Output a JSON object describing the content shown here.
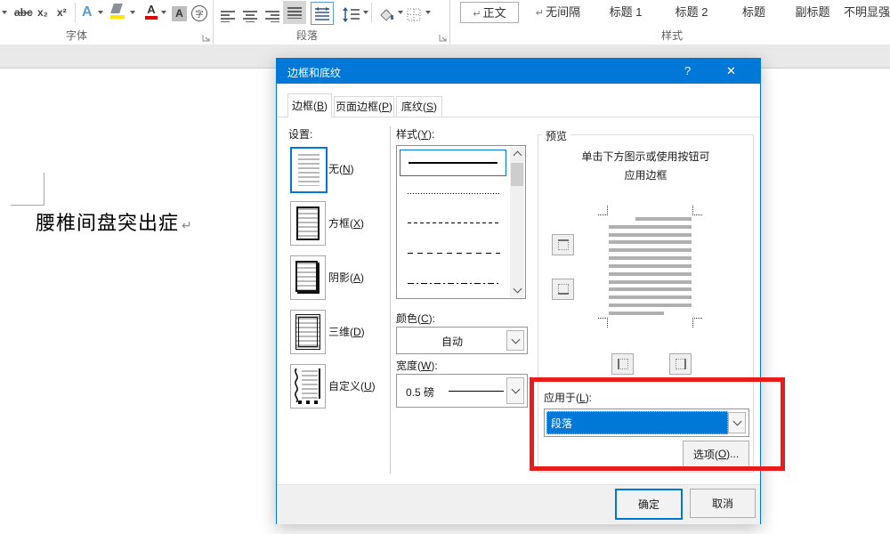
{
  "colors": {
    "accent": "#0078d7",
    "annotation_red": "#ea1b1b",
    "highlight_yellow": "#ffe400",
    "font_color_red": "#e00000"
  },
  "ribbon": {
    "groups": {
      "font": "字体",
      "paragraph": "段落",
      "styles": "样式"
    },
    "font_icons": {
      "strikethrough": "abc",
      "subscript": "x₂",
      "superscript": "x²",
      "text_effects": "A",
      "font_color": "A",
      "char_shading": "A",
      "enclose": "字"
    },
    "style_gallery": [
      {
        "prefix": "↵",
        "label": "正文"
      },
      {
        "prefix": "↵",
        "label": "无间隔"
      },
      {
        "prefix": "",
        "label": "标题 1"
      },
      {
        "prefix": "",
        "label": "标题 2"
      },
      {
        "prefix": "",
        "label": "标题"
      },
      {
        "prefix": "",
        "label": "副标题"
      },
      {
        "prefix": "",
        "label": "不明显强"
      }
    ]
  },
  "document": {
    "text": "腰椎间盘突出症",
    "paragraph_mark": "↵"
  },
  "dialog": {
    "title": "边框和底纹",
    "help_glyph": "?",
    "close_glyph": "✕",
    "tabs": [
      {
        "label": "边框(B)"
      },
      {
        "label": "页面边框(P)"
      },
      {
        "label": "底纹(S)"
      }
    ],
    "settings": {
      "label": "设置:",
      "options": [
        {
          "label": "无(N)"
        },
        {
          "label": "方框(X)"
        },
        {
          "label": "阴影(A)"
        },
        {
          "label": "三维(D)"
        },
        {
          "label": "自定义(U)"
        }
      ]
    },
    "style_list": {
      "label": "样式(Y):"
    },
    "color_combo": {
      "label": "颜色(C):",
      "value": "自动"
    },
    "width_combo": {
      "label": "宽度(W):",
      "value": "0.5 磅"
    },
    "preview": {
      "label": "预览",
      "instruction_line1": "单击下方图示或使用按钮可",
      "instruction_line2": "应用边框"
    },
    "apply_to": {
      "label": "应用于(L):",
      "value": "段落"
    },
    "options_button": "选项(O)...",
    "ok_button": "确定",
    "cancel_button": "取消"
  }
}
